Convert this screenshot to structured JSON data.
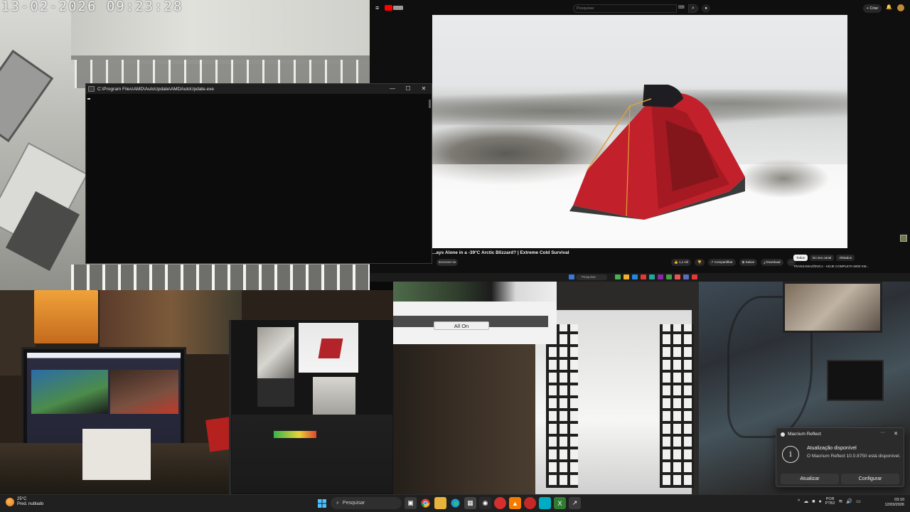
{
  "camera_top_left": {
    "timestamp": "13-02-2026  09:23:28"
  },
  "console_window": {
    "title": "C:\\Program Files\\AMD\\AutoUpdate\\AMDAutoUpdate.exe",
    "minimize": "—",
    "maximize": "☐",
    "close": "✕"
  },
  "youtube": {
    "menu_icon": "≡",
    "search_placeholder": "Pesquisar",
    "create_label": "+ Criar",
    "video_title": "...ays Alone in a -39°C Arctic Blizzard? | Extreme Cold Survival",
    "subscribe_label": "Inscrever-se",
    "actions": [
      "👍 1,1 mil",
      "👎",
      "↗ Compartilhar",
      "⊞ Salvar",
      "⤓ Download",
      "⋯"
    ],
    "chips": [
      "Todos",
      "Do seu canal",
      "Afetados"
    ],
    "recommended_title": "TRANSAMAZÔNICA - HOJE COMPLETA 5000 KM..."
  },
  "remote_popup": {
    "button_label": "All On"
  },
  "remote_strip": {
    "search_label": "Pesquisar"
  },
  "toast": {
    "app_name": "Macrium Reflect",
    "more_icon": "···",
    "close_icon": "✕",
    "info_icon": "i",
    "title": "Atualização disponível",
    "body": "O Macrium Reflect 10.0.8750 está disponível.",
    "button_update": "Atualizar",
    "button_configure": "Configurar"
  },
  "taskbar": {
    "weather_temp": "25°C",
    "weather_desc": "Pred. nublado",
    "search_label": "Pesquisar",
    "lang_top": "POR",
    "lang_bottom": "PTB2",
    "time": "03:10",
    "date": "12/03/2026",
    "accent": "#0078d4"
  }
}
